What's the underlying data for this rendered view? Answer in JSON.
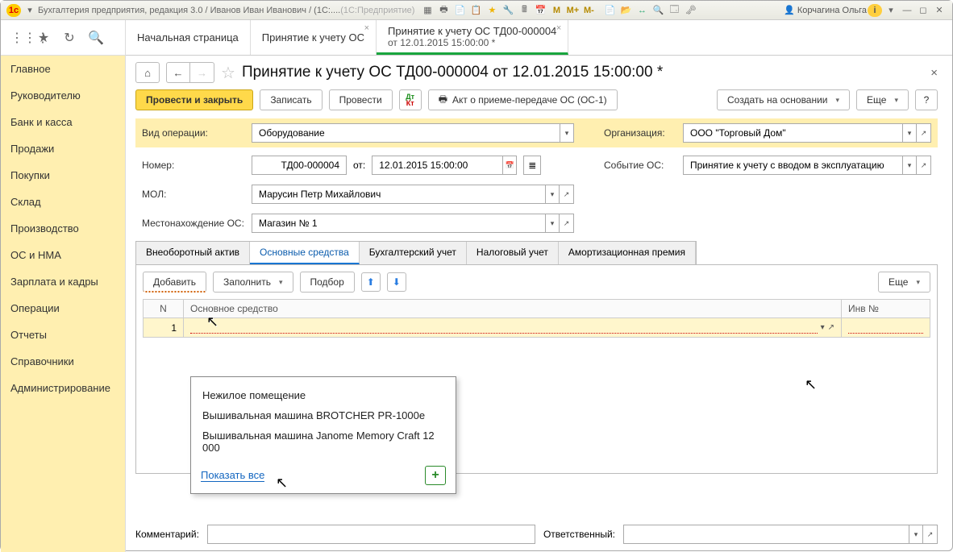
{
  "titlebar": {
    "text_main": "Бухгалтерия предприятия, редакция 3.0 / Иванов Иван Иванович / (1С:....",
    "text_suffix": "(1С:Предприятие)",
    "user": "Корчагина Ольга",
    "m": "M",
    "mplus": "M+",
    "mminus": "M-",
    "i_label": "i"
  },
  "left_nav": [
    "Главное",
    "Руководителю",
    "Банк и касса",
    "Продажи",
    "Покупки",
    "Склад",
    "Производство",
    "ОС и НМА",
    "Зарплата и кадры",
    "Операции",
    "Отчеты",
    "Справочники",
    "Администрирование"
  ],
  "tabs": [
    {
      "label": "Начальная страница",
      "closable": false
    },
    {
      "label": "Принятие к учету ОС",
      "closable": true
    },
    {
      "label": "Принятие к учету ОС ТД00-000004",
      "label2": "от 12.01.2015 15:00:00 *",
      "closable": true,
      "active": true
    }
  ],
  "page_title": "Принятие к учету ОС ТД00-000004 от 12.01.2015 15:00:00 *",
  "toolbar": {
    "post_close": "Провести и закрыть",
    "save": "Записать",
    "post": "Провести",
    "act": "Акт о приеме-передаче ОС (ОС-1)",
    "create_based": "Создать на основании",
    "more": "Еще",
    "help": "?"
  },
  "form": {
    "op_type_label": "Вид операции:",
    "op_type_value": "Оборудование",
    "org_label": "Организация:",
    "org_value": "ООО \"Торговый Дом\"",
    "number_label": "Номер:",
    "number_value": "ТД00-000004",
    "from_label": "от:",
    "date_value": "12.01.2015 15:00:00",
    "event_label": "Событие ОС:",
    "event_value": "Принятие к учету с вводом в эксплуатацию",
    "mol_label": "МОЛ:",
    "mol_value": "Марусин Петр Михайлович",
    "loc_label": "Местонахождение ОС:",
    "loc_value": "Магазин № 1"
  },
  "inner_tabs": [
    "Внеоборотный актив",
    "Основные средства",
    "Бухгалтерский учет",
    "Налоговый учет",
    "Амортизационная премия"
  ],
  "inner_active": 1,
  "panel_toolbar": {
    "add": "Добавить",
    "fill": "Заполнить",
    "pick": "Подбор",
    "more": "Еще"
  },
  "grid": {
    "col_n": "N",
    "col_os": "Основное средство",
    "col_inv": "Инв №",
    "rows": [
      {
        "n": "1",
        "os": "",
        "inv": ""
      }
    ]
  },
  "dropdown": {
    "items": [
      "Нежилое помещение",
      "Вышивальная машина BROTCHER PR-1000e",
      "Вышивальная машина Janome Memory Craft 12 000"
    ],
    "show_all": "Показать все"
  },
  "footer": {
    "comment_label": "Комментарий:",
    "resp_label": "Ответственный:"
  }
}
